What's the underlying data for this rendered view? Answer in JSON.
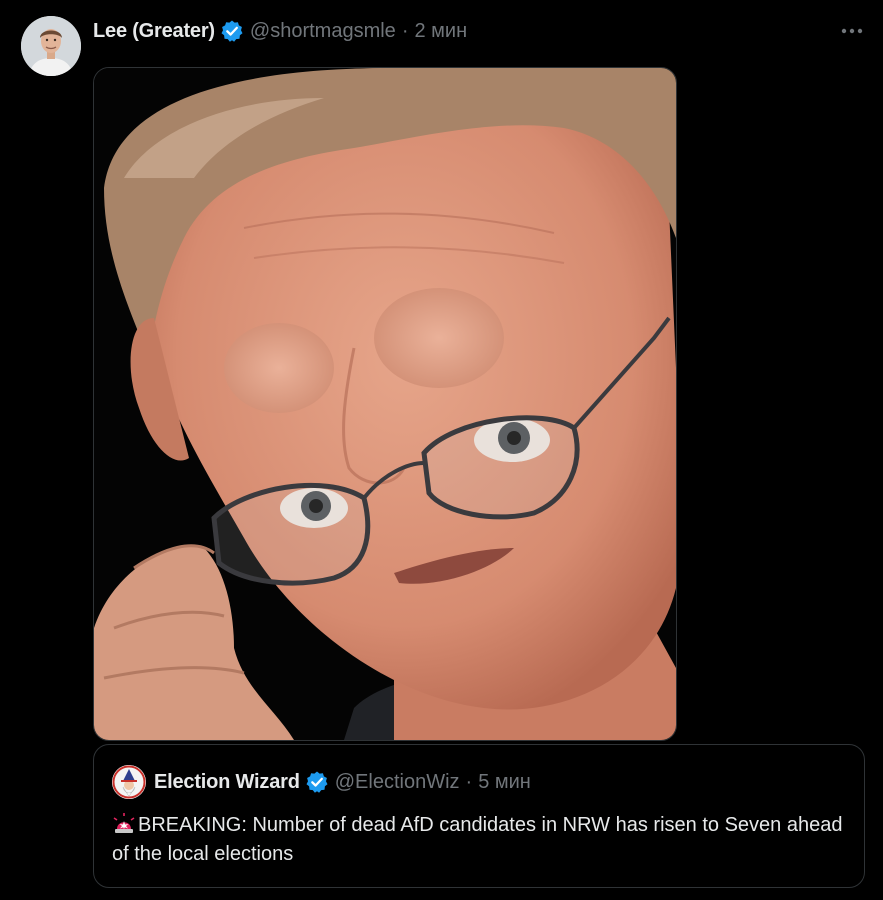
{
  "tweet": {
    "author_name": "Lee (Greater)",
    "handle": "@shortmagsmle",
    "separator": "·",
    "time": "2 мин",
    "verified_icon": "verified-badge-icon",
    "more_icon": "more-options-icon",
    "media": {
      "type": "photo",
      "alt": ""
    }
  },
  "quote": {
    "author_name": "Election Wizard",
    "handle": "@ElectionWiz",
    "separator": "·",
    "time": "5 мин",
    "verified_icon": "verified-badge-icon",
    "text_icon": "siren-icon",
    "text": "BREAKING: Number of dead AfD candidates in NRW has risen to Seven ahead of the local elections"
  },
  "colors": {
    "background": "#000000",
    "primary_text": "#e7e9ea",
    "secondary_text": "#71767b",
    "verified_blue": "#1d9bf0",
    "border": "#2f3336"
  }
}
